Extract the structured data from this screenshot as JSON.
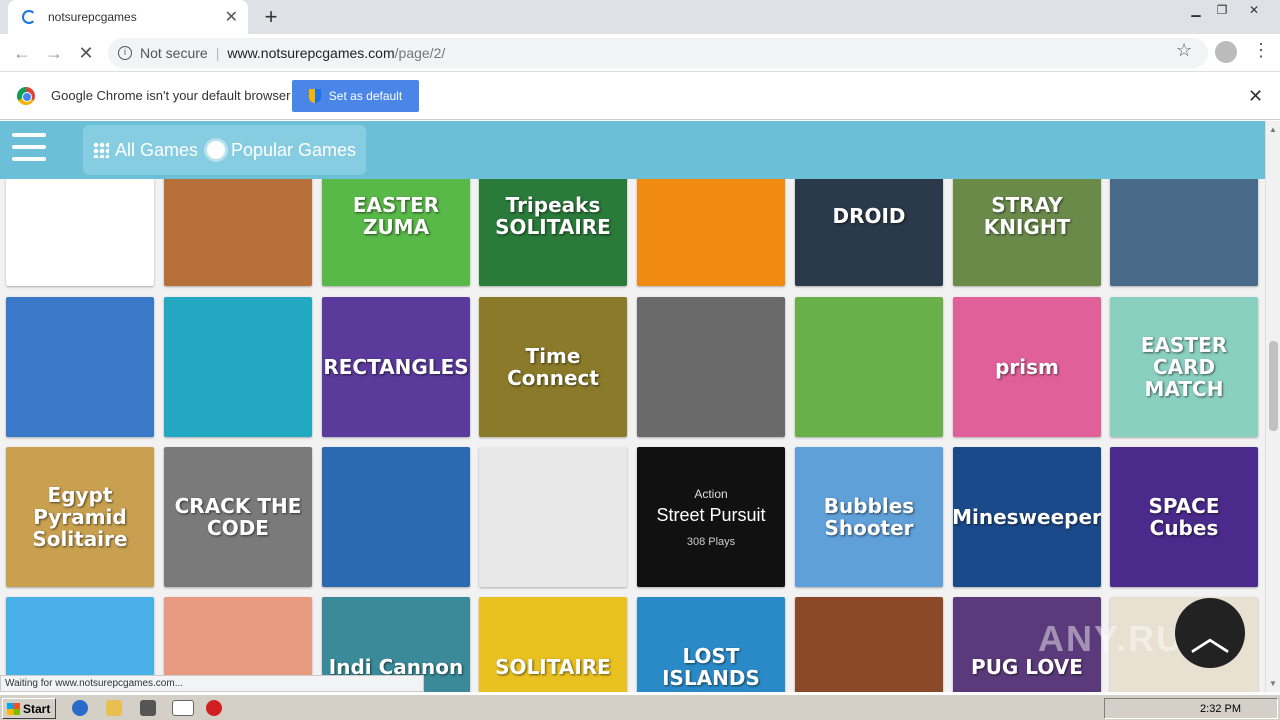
{
  "browser": {
    "tab_title": "notsurepcgames",
    "security_label": "Not secure",
    "url_domain": "www.notsurepcgames.com",
    "url_path": "/page/2/",
    "status_text": "Waiting for www.notsurepcgames.com..."
  },
  "infobar": {
    "message": "Google Chrome isn't your default browser",
    "button_label": "Set as default"
  },
  "site": {
    "nav": {
      "all_games": "All Games",
      "popular_games": "Popular Games"
    },
    "hover_card": {
      "category": "Action",
      "name": "Street Pursuit",
      "plays": "308 Plays"
    }
  },
  "tiles": [
    {
      "label": "",
      "color": "#ffffff"
    },
    {
      "label": "",
      "color": "#b8703a"
    },
    {
      "label": "EASTER ZUMA",
      "color": "#58b848"
    },
    {
      "label": "Tripeaks SOLITAIRE",
      "color": "#2a7a3a"
    },
    {
      "label": "",
      "color": "#f08a10"
    },
    {
      "label": "DROID",
      "color": "#2a3a4a"
    },
    {
      "label": "STRAY KNIGHT",
      "color": "#6a8a4a"
    },
    {
      "label": "",
      "color": "#4a6a8a"
    },
    {
      "label": "",
      "color": "#3a78c8"
    },
    {
      "label": "",
      "color": "#22a8c0"
    },
    {
      "label": "RECTANGLES",
      "color": "#5a3a9a"
    },
    {
      "label": "Time Connect",
      "color": "#8a7a2a"
    },
    {
      "label": "",
      "color": "#6a6a6a"
    },
    {
      "label": "",
      "color": "#6ab04a"
    },
    {
      "label": "prism",
      "color": "#e0609a"
    },
    {
      "label": "EASTER CARD MATCH",
      "color": "#8ad0c0"
    },
    {
      "label": "Egypt Pyramid Solitaire",
      "color": "#c8a050"
    },
    {
      "label": "CRACK THE CODE",
      "color": "#7a7a7a"
    },
    {
      "label": "",
      "color": "#2a6ab0"
    },
    {
      "label": "",
      "color": "#e8e8e8"
    },
    {
      "label": "",
      "color": "#111111"
    },
    {
      "label": "Bubbles Shooter",
      "color": "#60a0d8"
    },
    {
      "label": "Minesweeper",
      "color": "#1a4a8a"
    },
    {
      "label": "SPACE Cubes",
      "color": "#4a2a8a"
    },
    {
      "label": "",
      "color": "#4ab0e8"
    },
    {
      "label": "",
      "color": "#e89a80"
    },
    {
      "label": "Indi Cannon",
      "color": "#3a8a9a"
    },
    {
      "label": "SOLITAIRE",
      "color": "#e8c020"
    },
    {
      "label": "LOST ISLANDS",
      "color": "#2a8ac8"
    },
    {
      "label": "",
      "color": "#8a4a2a"
    },
    {
      "label": "PUG LOVE",
      "color": "#5a3a7a"
    },
    {
      "label": "",
      "color": "#e8e0d0"
    }
  ],
  "watermark": "ANY.RUN",
  "taskbar": {
    "start_label": "Start",
    "clock": "2:32 PM"
  }
}
